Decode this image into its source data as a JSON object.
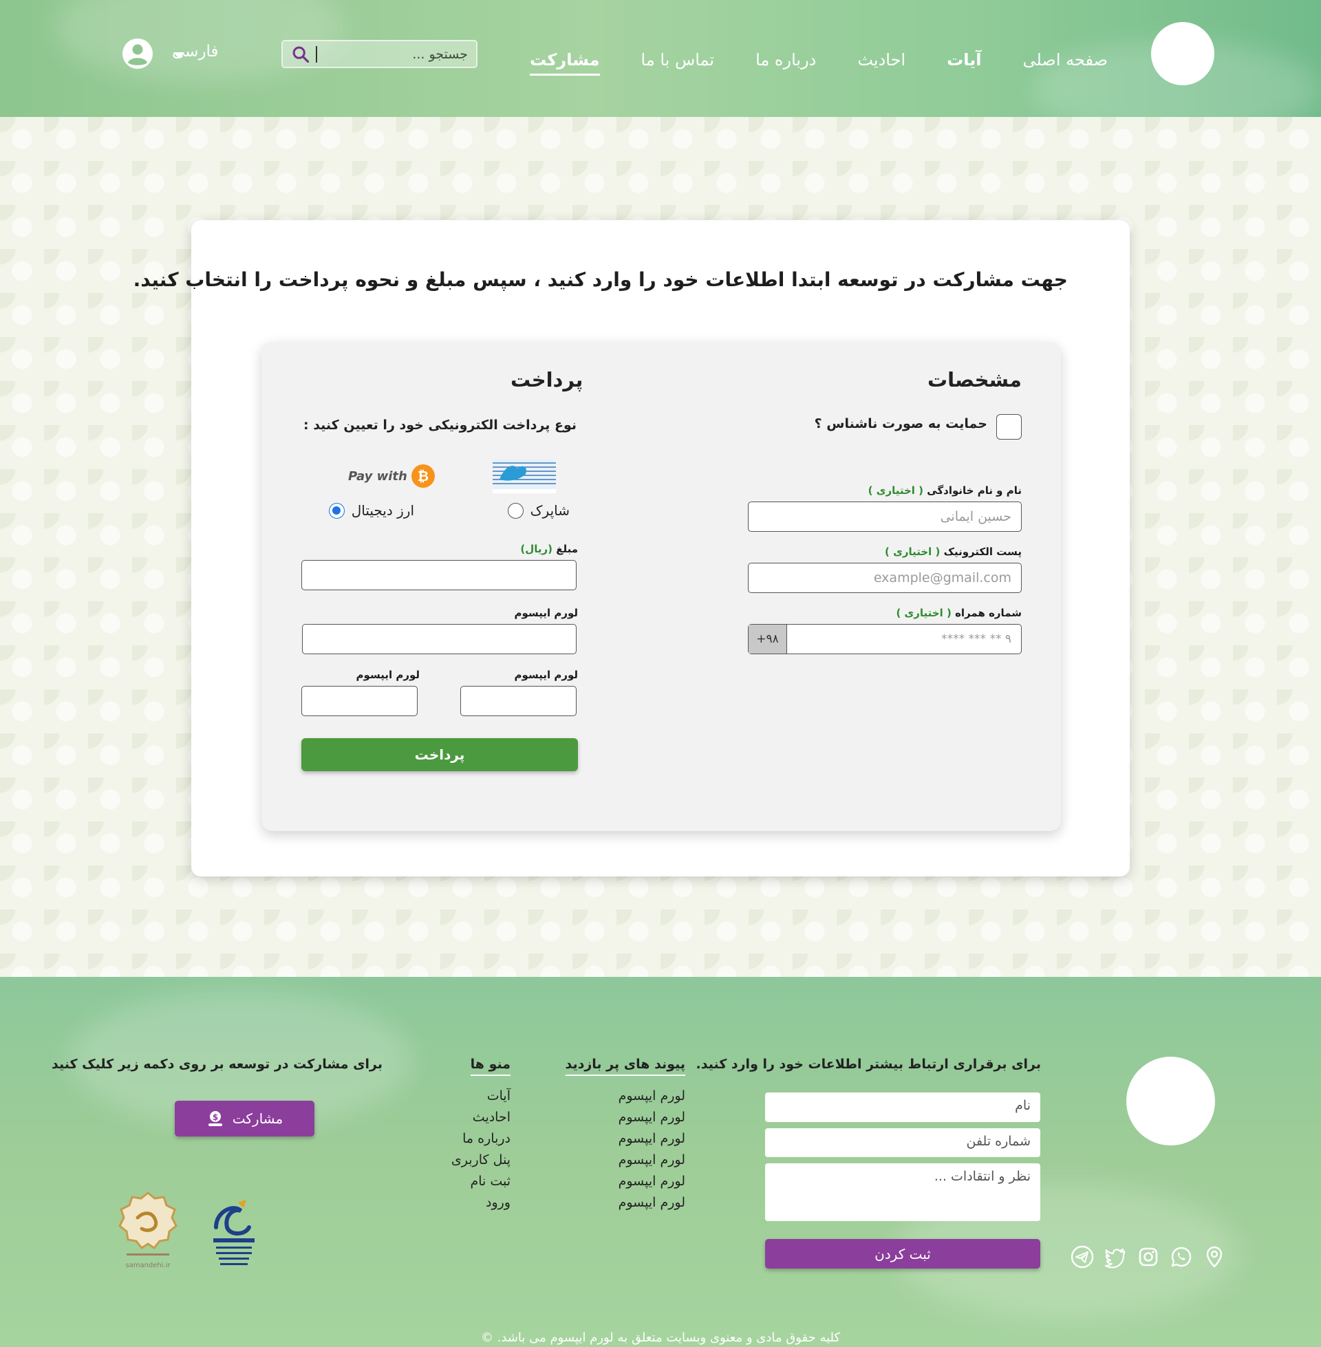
{
  "header": {
    "nav": [
      {
        "label": "صفحه اصلی",
        "style": "normal"
      },
      {
        "label": "آیات",
        "style": "bold"
      },
      {
        "label": "احادیث",
        "style": "normal"
      },
      {
        "label": "درباره ما",
        "style": "normal"
      },
      {
        "label": "تماس با ما",
        "style": "normal"
      },
      {
        "label": "مشارکت",
        "style": "active"
      }
    ],
    "search_placeholder": "جستجو ...",
    "language": "فارسی"
  },
  "main": {
    "heading": "جهت مشارکت در توسعه ابتدا اطلاعات خود را وارد کنید ، سپس مبلغ و نحوه پرداخت را انتخاب کنید.",
    "details": {
      "title": "مشخصات",
      "anonymous_label": "حمایت به صورت ناشناس ؟",
      "name_label": "نام و نام خانوادگی",
      "name_optional": "( اختیاری )",
      "name_placeholder": "حسین ایمانی",
      "email_label": "پست الکترونیک",
      "email_optional": "( اختیاری )",
      "email_placeholder": "example@gmail.com",
      "phone_label": "شماره همراه",
      "phone_optional": "( اختیاری )",
      "phone_prefix": "+۹۸",
      "phone_placeholder": "۹ ** *** ****"
    },
    "payment": {
      "title": "پرداخت",
      "type_label": "نوع پرداخت الکترونیکی خود را تعیین کنید :",
      "option_shaparak": "شاپرک",
      "option_crypto": "ارز دیجیتال",
      "paywith_text": "Pay with",
      "btc_symbol": "₿",
      "selected_option": "crypto",
      "amount_label": "مبلغ",
      "amount_unit": "(ریال)",
      "field2_label": "لورم ایپسوم",
      "field3_label": "لورم ایپسوم",
      "field4_label": "لورم ایپسوم",
      "button": "پرداخت"
    }
  },
  "footer": {
    "contact_heading": "برای برقراری ارتباط بیشتر اطلاعات خود را وارد کنید.",
    "name_placeholder": "نام",
    "phone_placeholder": "شماره تلفن",
    "comment_placeholder": "نظر و انتقادات ...",
    "submit": "ثبت کردن",
    "links_heading": "پیوند های پر بازدید",
    "links": [
      "لورم ایپسوم",
      "لورم ایپسوم",
      "لورم ایپسوم",
      "لورم ایپسوم",
      "لورم ایپسوم",
      "لورم ایپسوم"
    ],
    "menu_heading": "منو ها",
    "menu": [
      "آیات",
      "احادیث",
      "درباره ما",
      "پنل کاربری",
      "ثبت نام",
      "ورود"
    ],
    "cta_heading": "برای مشارکت در توسعه بر روی دکمه زیر کلیک کنید",
    "cta_button": "مشارکت",
    "samandehi_text": "samandehi.ir",
    "copyright": "کلیه حقوق مادی و معنوی وبسایت متعلق به لورم ایپسوم می باشد.",
    "social_icons": [
      "telegram-icon",
      "twitter-icon",
      "instagram-icon",
      "whatsapp-icon",
      "location-icon"
    ]
  },
  "colors": {
    "header_green": "#8ec68f",
    "pay_button": "#4c9a3f",
    "purple": "#8c3e9c",
    "optional_green": "#2f8b2f"
  }
}
